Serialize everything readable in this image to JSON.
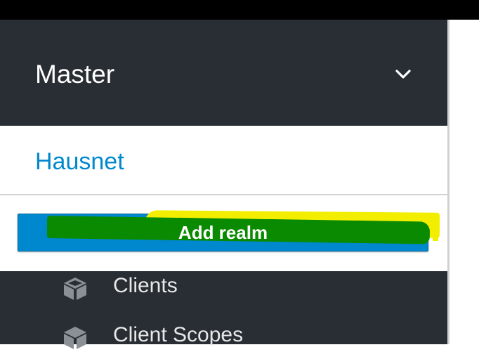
{
  "realm_selector": {
    "current_realm": "Master",
    "chevron_icon": "chevron-down-icon",
    "options": [
      {
        "label": "Hausnet"
      }
    ],
    "add_realm_label": "Add realm"
  },
  "nav": {
    "items": [
      {
        "label": "Clients",
        "icon": "cube-icon"
      },
      {
        "label": "Client Scopes",
        "icon": "cubes-icon"
      }
    ]
  },
  "colors": {
    "sidebar_bg": "#292e34",
    "accent": "#0088ce",
    "annotation_green": "#0a8a00",
    "annotation_yellow": "#f3ee00"
  }
}
